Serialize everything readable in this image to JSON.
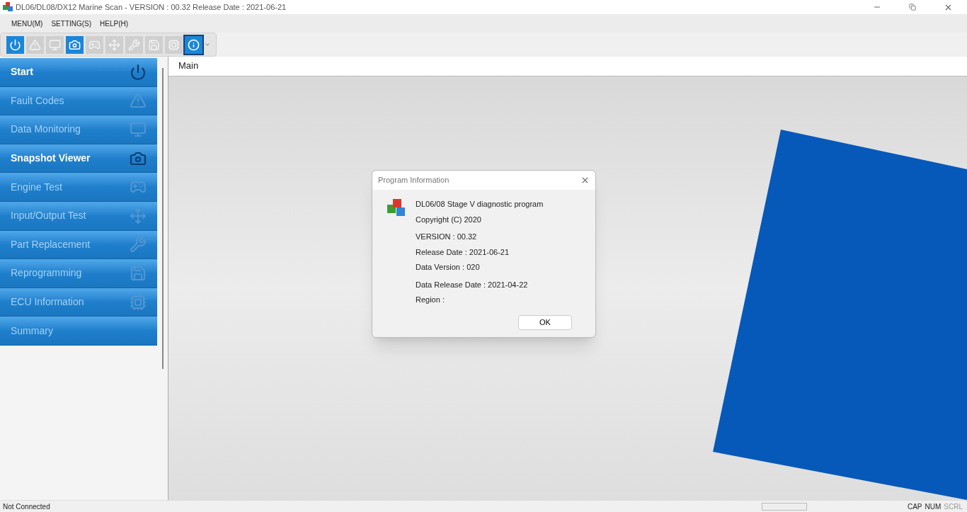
{
  "window": {
    "title": "DL06/DL08/DX12 Marine Scan - VERSION : 00.32 Release Date : 2021-06-21"
  },
  "menu": [
    "MENU(M)",
    "SETTING(S)",
    "HELP(H)"
  ],
  "toolbar": [
    {
      "kind": "power",
      "enabled": true,
      "selected": false
    },
    {
      "kind": "warning",
      "enabled": false,
      "selected": false
    },
    {
      "kind": "monitor",
      "enabled": false,
      "selected": false
    },
    {
      "kind": "camera",
      "enabled": true,
      "selected": false
    },
    {
      "kind": "engine",
      "enabled": false,
      "selected": false
    },
    {
      "kind": "io",
      "enabled": false,
      "selected": false
    },
    {
      "kind": "part",
      "enabled": false,
      "selected": false
    },
    {
      "kind": "reprogram",
      "enabled": false,
      "selected": false
    },
    {
      "kind": "ecu",
      "enabled": false,
      "selected": false
    },
    {
      "kind": "info",
      "enabled": true,
      "selected": true
    }
  ],
  "sidebar": {
    "items": [
      {
        "label": "Start",
        "kind": "power",
        "enabled": true
      },
      {
        "label": "Fault Codes",
        "kind": "warning",
        "enabled": false
      },
      {
        "label": "Data Monitoring",
        "kind": "monitor",
        "enabled": false
      },
      {
        "label": "Snapshot Viewer",
        "kind": "camera",
        "enabled": true
      },
      {
        "label": "Engine Test",
        "kind": "engine",
        "enabled": false
      },
      {
        "label": "Input/Output Test",
        "kind": "io",
        "enabled": false
      },
      {
        "label": "Part Replacement",
        "kind": "part",
        "enabled": false
      },
      {
        "label": "Reprogramming",
        "kind": "reprogram",
        "enabled": false
      },
      {
        "label": "ECU Information",
        "kind": "ecu",
        "enabled": false
      },
      {
        "label": "Summary",
        "kind": "none",
        "enabled": false
      }
    ]
  },
  "main": {
    "tab": "Main"
  },
  "dialog": {
    "title": "Program Information",
    "lines": [
      "DL06/08 Stage V diagnostic program",
      "Copyright (C) 2020",
      "VERSION : 00.32",
      "Release Date : 2021-06-21",
      "Data Version : 020",
      "Data Release Date : 2021-04-22",
      "Region :"
    ],
    "button": "OK"
  },
  "status_bar": {
    "connection": "Not Connected",
    "indicators": [
      {
        "label": "CAP",
        "on": true
      },
      {
        "label": "NUM",
        "on": true
      },
      {
        "label": "SCRL",
        "on": false
      }
    ]
  }
}
